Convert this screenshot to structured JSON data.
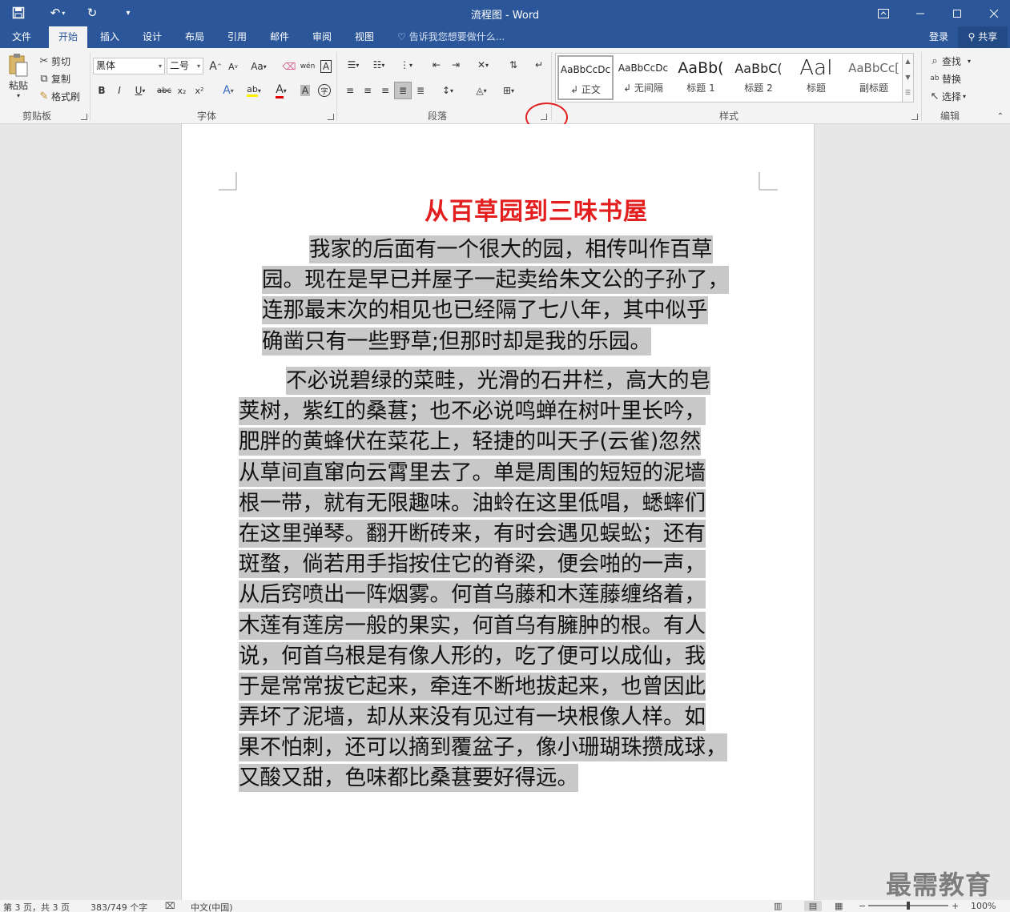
{
  "titlebar": {
    "doc_title": "流程图 - Word",
    "save_icon": "save-icon",
    "undo_icon": "undo-icon",
    "redo_icon": "redo-icon",
    "customize_icon": "customize-quick-access-icon",
    "restore_icon": "ribbon-display-options-icon",
    "minimize_icon": "minimize-icon",
    "maximize_icon": "maximize-icon",
    "close_icon": "close-icon"
  },
  "tabs": [
    {
      "label": "文件"
    },
    {
      "label": "开始"
    },
    {
      "label": "插入"
    },
    {
      "label": "设计"
    },
    {
      "label": "布局"
    },
    {
      "label": "引用"
    },
    {
      "label": "邮件"
    },
    {
      "label": "审阅"
    },
    {
      "label": "视图"
    }
  ],
  "tell_me": "告诉我您想要做什么...",
  "login": "登录",
  "share": "共享",
  "clipboard": {
    "label": "剪贴板",
    "paste": "粘贴",
    "cut": "剪切",
    "copy": "复制",
    "format_painter": "格式刷"
  },
  "font": {
    "label": "字体",
    "font_name": "黑体",
    "font_size": "二号",
    "case_btn": "Aa",
    "phonetic": "wén",
    "bold": "B",
    "italic": "I",
    "underline": "U",
    "strike": "abc",
    "subscript": "x₂",
    "superscript": "x²",
    "grow": "A",
    "shrink": "A",
    "font_color": "A",
    "char_shading": "A",
    "enclose": "字"
  },
  "paragraph": {
    "label": "段落"
  },
  "styles": {
    "label": "样式",
    "items": [
      {
        "preview": "AaBbCcDc",
        "name": "↲ 正文"
      },
      {
        "preview": "AaBbCcDc",
        "name": "↲ 无间隔"
      },
      {
        "preview": "AaBb(",
        "name": "标题 1"
      },
      {
        "preview": "AaBbC(",
        "name": "标题 2"
      },
      {
        "preview": "AaI",
        "name": "标题"
      },
      {
        "preview": "AaBbCc[",
        "name": "副标题"
      }
    ]
  },
  "editing": {
    "label": "编辑",
    "find": "查找",
    "replace": "替换",
    "select": "选择"
  },
  "document": {
    "heading": "从百草园到三味书屋",
    "para1_lines": [
      "我家的后面有一个很大的园，相传叫作百草",
      "园。现在是早已并屋子一起卖给朱文公的子孙了，",
      "连那最末次的相见也已经隔了七八年，其中似乎",
      "确凿只有一些野草;但那时却是我的乐园。"
    ],
    "para2_lines": [
      "不必说碧绿的菜畦，光滑的石井栏，高大的皂",
      "荚树，紫红的桑葚；也不必说鸣蝉在树叶里长吟，",
      "肥胖的黄蜂伏在菜花上，轻捷的叫天子(云雀)忽然",
      "从草间直窜向云霄里去了。单是周围的短短的泥墙",
      "根一带，就有无限趣味。油蛉在这里低唱，蟋蟀们",
      "在这里弹琴。翻开断砖来，有时会遇见蜈蚣；还有",
      "斑蝥，倘若用手指按住它的脊梁，便会啪的一声，",
      "从后窍喷出一阵烟雾。何首乌藤和木莲藤缠络着，",
      "木莲有莲房一般的果实，何首乌有臃肿的根。有人",
      "说，何首乌根是有像人形的，吃了便可以成仙，我",
      "于是常常拔它起来，牵连不断地拔起来，也曾因此",
      "弄坏了泥墙，却从来没有见过有一块根像人样。如",
      "果不怕刺，还可以摘到覆盆子，像小珊瑚珠攒成球，",
      "又酸又甜，色味都比桑葚要好得远。"
    ]
  },
  "status": {
    "page": "第 3 页，共 3 页",
    "words": "383/749 个字",
    "language": "中文(中国)",
    "zoom": "100%"
  },
  "watermark": "最需教育",
  "colors": {
    "brand": "#2b579a",
    "heading": "#e31e1e",
    "selection": "#c8c8c8",
    "highlight_circle": "#e02020"
  }
}
